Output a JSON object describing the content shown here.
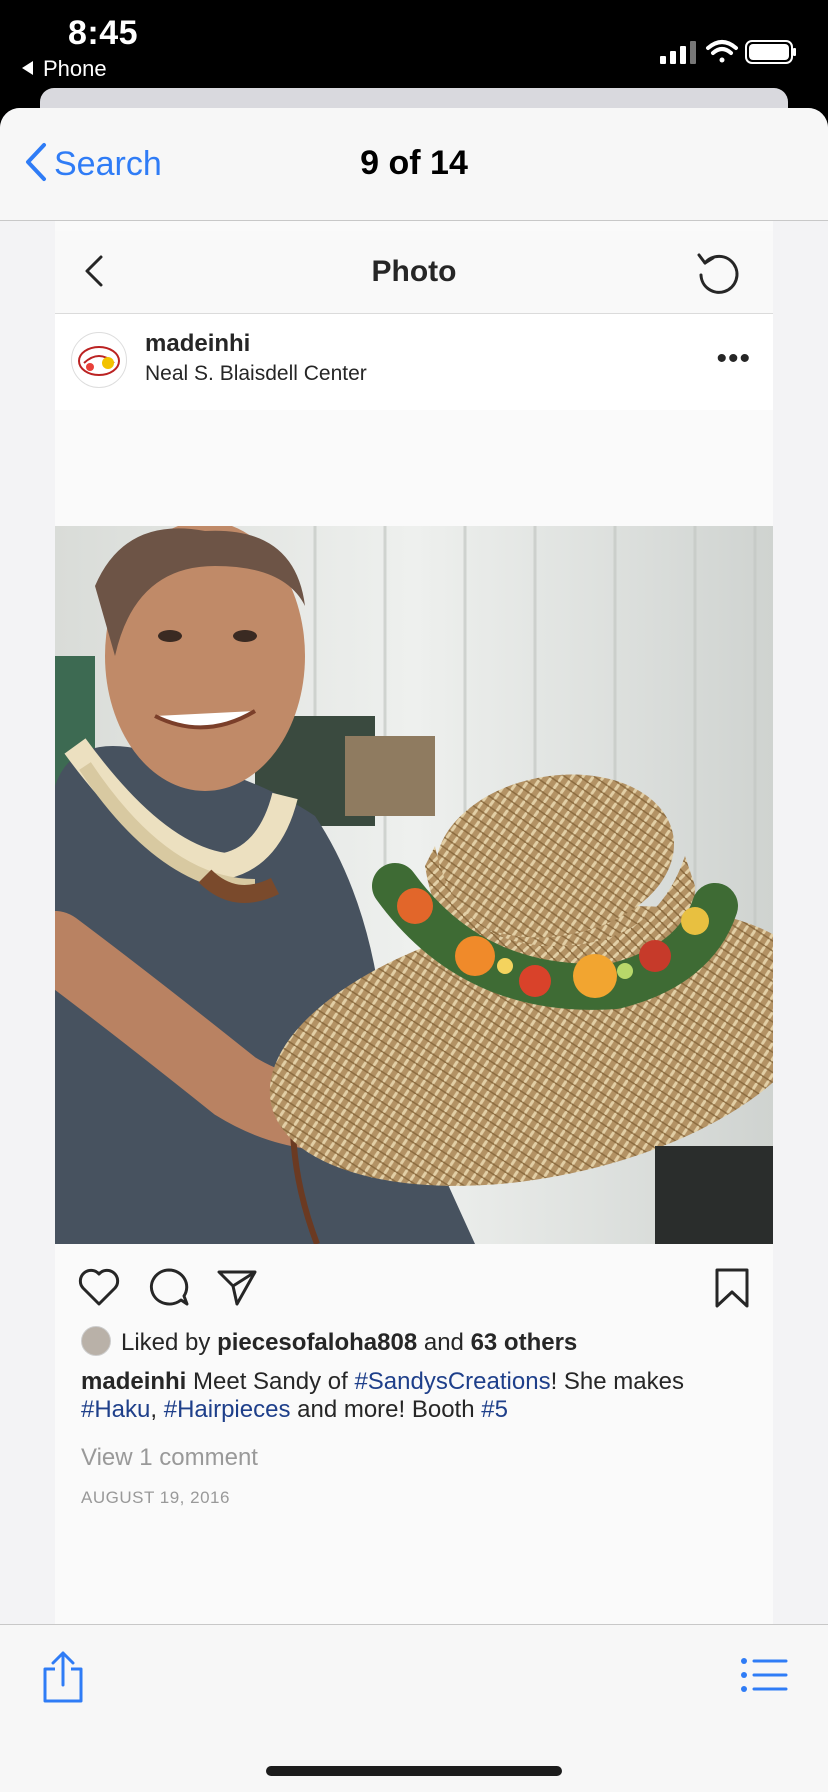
{
  "status_bar": {
    "time": "8:45",
    "back_app": "Phone"
  },
  "nav": {
    "back_label": "Search",
    "title": "9 of 14"
  },
  "instagram": {
    "header_title": "Photo",
    "post": {
      "username": "madeinhi",
      "location": "Neal S. Blaisdell Center",
      "more": "•••",
      "likes": {
        "prefix": "Liked by ",
        "user": "piecesofaloha808",
        "middle": " and ",
        "others": "63 others"
      },
      "caption": {
        "author": "madeinhi",
        "text_1": " Meet Sandy of ",
        "tag_1": "#SandysCreations",
        "text_2": "! She makes ",
        "tag_2": "#Haku",
        "text_3": ", ",
        "tag_3": "#Hairpieces",
        "text_4": " and more! Booth ",
        "tag_4": "#5"
      },
      "view_comments": "View 1 comment",
      "date": "AUGUST 19, 2016"
    }
  },
  "colors": {
    "ios_blue": "#2f7cf6",
    "hashtag": "#1e3f8a"
  }
}
